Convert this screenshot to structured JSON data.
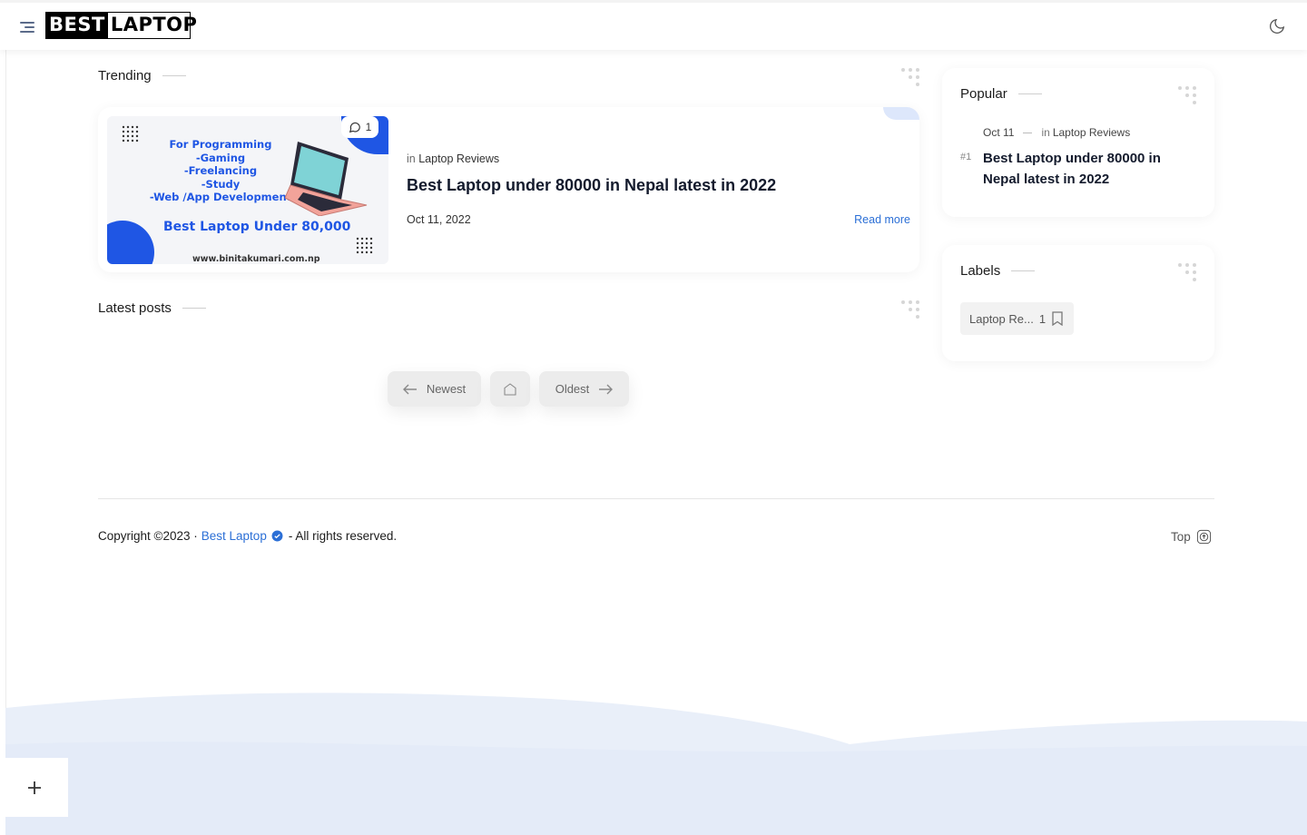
{
  "header": {
    "logo_part1": "BEST",
    "logo_part2": "LAPTOP"
  },
  "trending": {
    "title": "Trending",
    "post": {
      "comment_count": "1",
      "in_label": "in",
      "category": "Laptop Reviews",
      "title": "Best Laptop under 80000 in Nepal latest in 2022",
      "date": "Oct 11, 2022",
      "read_more": "Read more",
      "thumbnail": {
        "lines": [
          "For Programming",
          "-Gaming",
          "-Freelancing",
          "-Study",
          "-Web /App Development"
        ],
        "headline": "Best Laptop Under 80,000",
        "url": "www.binitakumari.com.np"
      }
    }
  },
  "latest": {
    "title": "Latest posts"
  },
  "pager": {
    "newest": "Newest",
    "oldest": "Oldest"
  },
  "popular": {
    "title": "Popular",
    "item": {
      "date": "Oct 11",
      "in_label": "in",
      "category": "Laptop Reviews",
      "rank": "#1",
      "title": "Best Laptop under 80000 in Nepal latest in 2022"
    }
  },
  "labels": {
    "title": "Labels",
    "items": [
      {
        "name": "Laptop Re...",
        "count": "1"
      }
    ]
  },
  "footer": {
    "copyright": "Copyright ©2023 ·",
    "brand": "Best Laptop",
    "rights": "- All rights reserved.",
    "top": "Top"
  },
  "colors": {
    "accent": "#2b6fd6",
    "brand_blue": "#1f56e4",
    "wave": "#e6edfb"
  }
}
